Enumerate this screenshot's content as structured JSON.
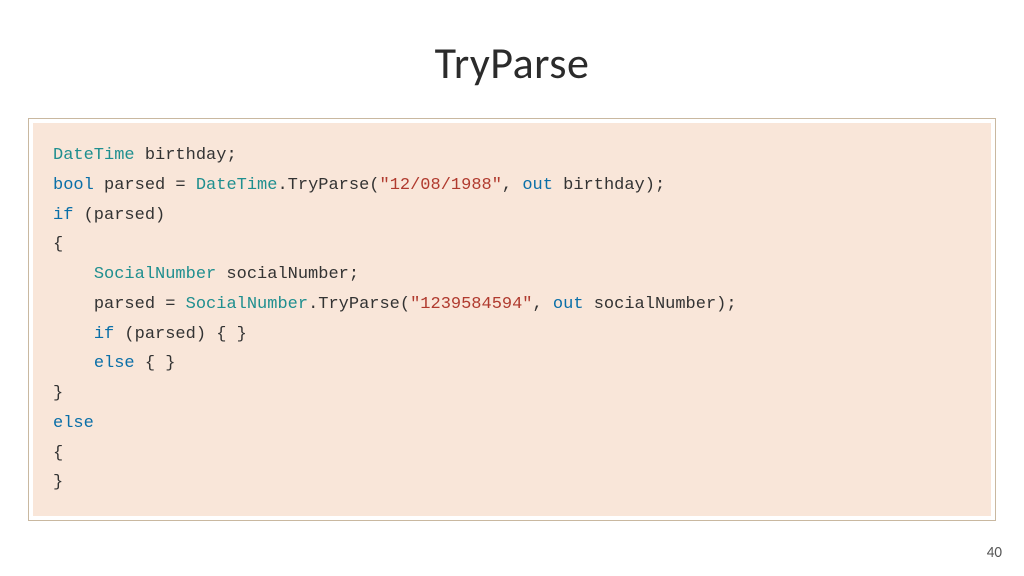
{
  "title": "TryParse",
  "page_number": "40",
  "code": {
    "l1": {
      "t1": "DateTime",
      "t2": " birthday;"
    },
    "l2": {
      "t1": "bool",
      "t2": " parsed = ",
      "t3": "DateTime",
      "t4": ".TryParse(",
      "t5": "\"12/08/1988\"",
      "t6": ", ",
      "t7": "out",
      "t8": " birthday);"
    },
    "l3": {
      "t1": "if",
      "t2": " (parsed)"
    },
    "l4": {
      "t1": "{"
    },
    "l5": {
      "indent": "    ",
      "t1": "SocialNumber",
      "t2": " socialNumber;"
    },
    "l6": {
      "indent": "    ",
      "t1": "parsed = ",
      "t2": "SocialNumber",
      "t3": ".TryParse(",
      "t4": "\"1239584594\"",
      "t5": ", ",
      "t6": "out",
      "t7": " socialNumber);"
    },
    "l7": {
      "indent": "    ",
      "t1": "if",
      "t2": " (parsed) { }"
    },
    "l8": {
      "indent": "    ",
      "t1": "else",
      "t2": " { }"
    },
    "l9": {
      "t1": "}"
    },
    "l10": {
      "t1": "else"
    },
    "l11": {
      "t1": "{"
    },
    "l12": {
      "t1": "}"
    }
  }
}
